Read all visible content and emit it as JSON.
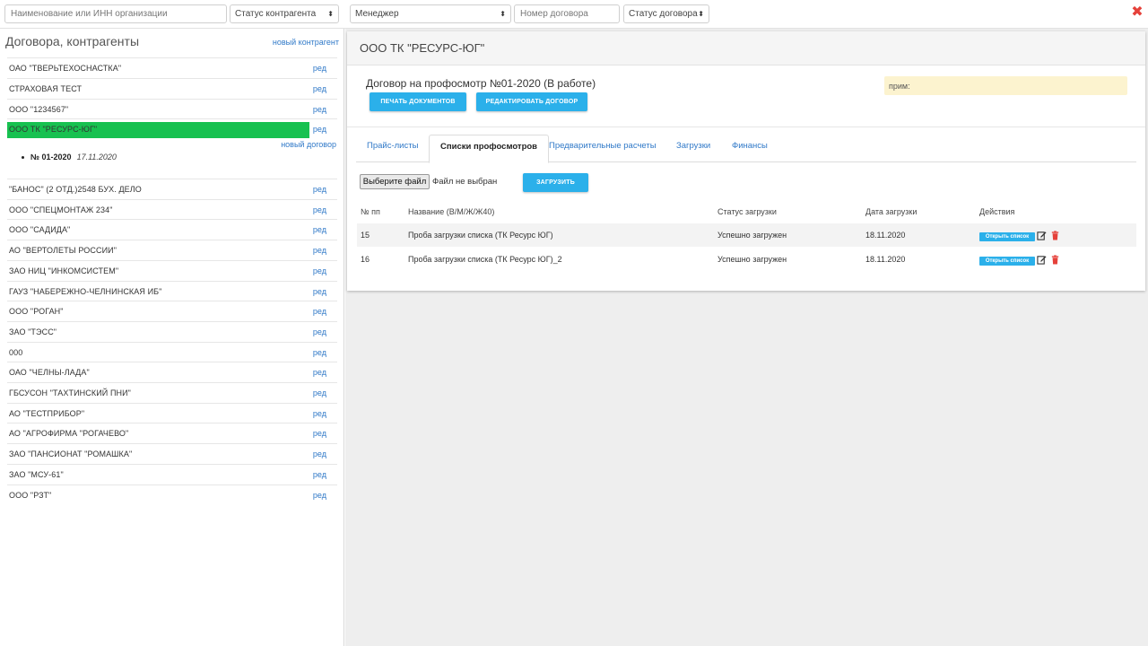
{
  "filters": {
    "org_placeholder": "Наименование или ИНН организации",
    "contractor_status": "Статус контрагента",
    "manager": "Менеджер",
    "contract_number_placeholder": "Номер договора",
    "contract_status": "Статус договора",
    "select_arrow": "⬍",
    "close": "✖"
  },
  "sidebar": {
    "title": "Договора, контрагенты",
    "new_contractor": "новый контрагент",
    "edit_label": "ред",
    "new_contract": "новый договор",
    "selected_contract": {
      "number": "№ 01-2020",
      "date": "17.11.2020"
    },
    "orgs_top": [
      "ОАО \"ТВЕРЬТЕХОСНАСТКА\"",
      "СТРАХОВАЯ ТЕСТ",
      "ООО \"1234567\"",
      "ООО ТК \"РЕСУРС-ЮГ\""
    ],
    "orgs_bottom": [
      "\"БАНОС\" (2 ОТД.)2548 БУХ. ДЕЛО",
      "ООО \"СПЕЦМОНТАЖ 234\"",
      "ООО \"САДИДА\"",
      "АО \"ВЕРТОЛЕТЫ РОССИИ\"",
      "ЗАО НИЦ \"ИНКОМСИСТЕМ\"",
      "ГАУЗ \"НАБЕРЕЖНО-ЧЕЛНИНСКАЯ ИБ\"",
      "ООО \"РОГАН\"",
      "ЗАО \"ТЭСС\"",
      "000",
      "ОАО \"ЧЕЛНЫ-ЛАДА\"",
      "ГБСУСОН \"ТАХТИНСКИЙ ПНИ\"",
      "АО \"ТЕСТПРИБОР\"",
      "АО \"АГРОФИРМА \"РОГАЧЕВО\"",
      "ЗАО \"ПАНСИОНАТ \"РОМАШКА\"",
      "ЗАО \"МСУ-61\"",
      "ООО \"РЗТ\""
    ]
  },
  "main": {
    "org_title": "ООО ТК \"РЕСУРС-ЮГ\"",
    "contract_title": "Договор на профосмотр №01-2020 (В работе)",
    "print_button": "ПЕЧАТЬ ДОКУМЕНТОВ",
    "edit_button": "РЕДАКТИРОВАТЬ ДОГОВОР",
    "note": "прим:",
    "tabs": [
      {
        "label": "Прайс-листы",
        "active": false
      },
      {
        "label": "Списки профосмотров",
        "active": true
      },
      {
        "label": "Предварительные расчеты",
        "active": false
      },
      {
        "label": "Загрузки",
        "active": false
      },
      {
        "label": "Финансы",
        "active": false
      }
    ],
    "file_button": "Выберите файл",
    "file_status": "Файл не выбран",
    "upload_button": "ЗАГРУЗИТЬ",
    "table": {
      "headers": [
        "№ пп",
        "Название (В/М/Ж/Ж40)",
        "Статус загрузки",
        "Дата загрузки",
        "Действия"
      ],
      "rows": [
        {
          "num": "15",
          "name": "Проба загрузки списка (ТК Ресурс ЮГ)",
          "status": "Успешно загружен",
          "date": "18.11.2020",
          "action": "Открыть список"
        },
        {
          "num": "16",
          "name": "Проба загрузки списка (ТК Ресурс ЮГ)_2",
          "status": "Успешно загружен",
          "date": "18.11.2020",
          "action": "Открыть список"
        }
      ]
    }
  },
  "colors": {
    "accent_blue": "#2bb0ea",
    "link_blue": "#3079c8",
    "selected_green": "#17c150",
    "delete_red": "#e5413a",
    "note_yellow": "#fcf3cf"
  },
  "icons": [
    "close-icon",
    "edit-icon",
    "trash-icon",
    "select-arrow-icon"
  ]
}
